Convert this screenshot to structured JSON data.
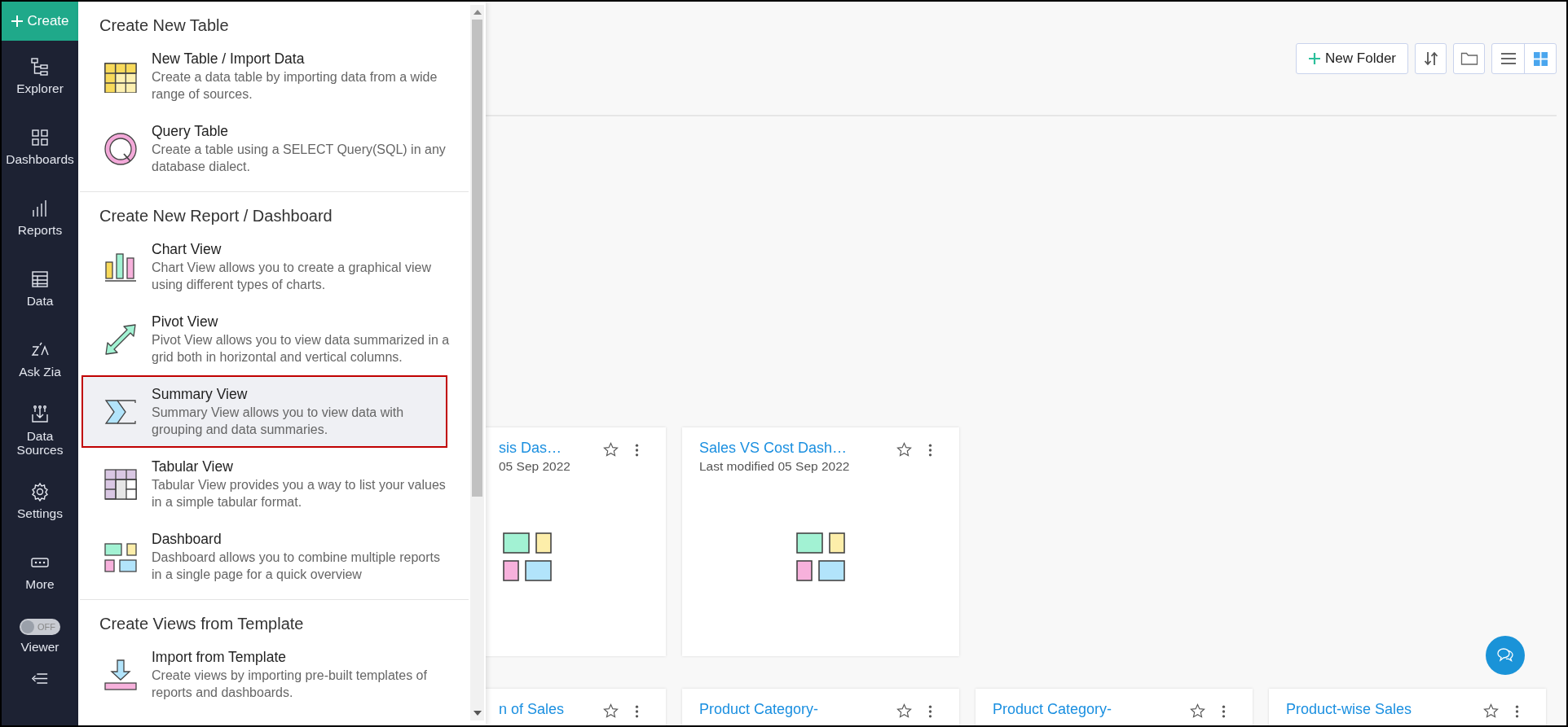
{
  "sidebar": {
    "create_label": "Create",
    "items": [
      {
        "label": "Explorer"
      },
      {
        "label": "Dashboards"
      },
      {
        "label": "Reports"
      },
      {
        "label": "Data"
      },
      {
        "label": "Ask Zia"
      },
      {
        "label": "Data Sources"
      },
      {
        "label": "Settings"
      },
      {
        "label": "More"
      }
    ],
    "viewer": {
      "label": "Viewer",
      "toggle_text": "OFF",
      "on": false
    }
  },
  "create_menu": {
    "sections": [
      {
        "title": "Create New Table",
        "items": [
          {
            "title": "New Table / Import Data",
            "description": "Create a data table by importing data from a wide range of sources.",
            "selected": false
          },
          {
            "title": "Query Table",
            "description": "Create a table using a SELECT Query(SQL) in any database dialect.",
            "selected": false
          }
        ]
      },
      {
        "title": "Create New Report / Dashboard",
        "items": [
          {
            "title": "Chart View",
            "description": "Chart View allows you to create a graphical view using different types of charts.",
            "selected": false
          },
          {
            "title": "Pivot View",
            "description": "Pivot View allows you to view data summarized in a grid both in horizontal and vertical columns.",
            "selected": false
          },
          {
            "title": "Summary View",
            "description": "Summary View allows you to view data with grouping and data summaries.",
            "selected": true
          },
          {
            "title": "Tabular View",
            "description": "Tabular View provides you a way to list your values in a simple tabular format.",
            "selected": false
          },
          {
            "title": "Dashboard",
            "description": "Dashboard allows you to combine multiple reports in a single page for a quick overview",
            "selected": false
          }
        ]
      },
      {
        "title": "Create Views from Template",
        "items": [
          {
            "title": "Import from Template",
            "description": "Create views by importing pre-built templates of reports and dashboards.",
            "selected": false
          }
        ]
      }
    ]
  },
  "toolbar": {
    "new_folder_label": "New Folder",
    "view_modes": [
      {
        "selected": false
      },
      {
        "selected": true
      }
    ]
  },
  "card_rows": [
    [
      {
        "title": "sis Das…",
        "subtitle": "05 Sep 2022",
        "favorite": false
      },
      {
        "title": "Sales VS Cost Dash…",
        "subtitle": "Last modified 05 Sep 2022",
        "favorite": false
      }
    ],
    [
      {
        "title": "n of Sales",
        "favorite": false
      },
      {
        "title": "Product Category-",
        "favorite": false
      },
      {
        "title": "Product Category-",
        "favorite": false
      },
      {
        "title": "Product-wise Sales",
        "favorite": false
      }
    ]
  ]
}
